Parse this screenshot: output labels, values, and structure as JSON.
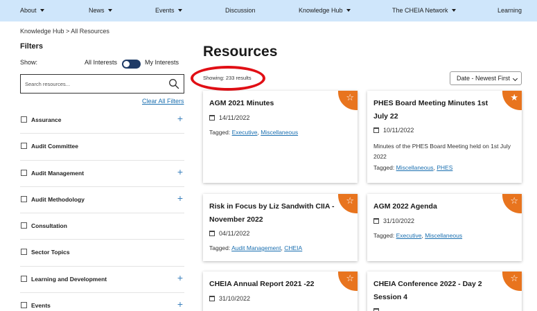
{
  "nav": {
    "items": [
      {
        "label": "About",
        "caret": true
      },
      {
        "label": "News",
        "caret": true
      },
      {
        "label": "Events",
        "caret": true
      },
      {
        "label": "Discussion",
        "caret": false
      },
      {
        "label": "Knowledge Hub",
        "caret": true
      },
      {
        "label": "The CHEIA Network",
        "caret": true
      },
      {
        "label": "Learning",
        "caret": false
      }
    ]
  },
  "breadcrumb": "Knowledge Hub > All Resources",
  "filters": {
    "title": "Filters",
    "show_label": "Show:",
    "all_interests": "All Interests",
    "my_interests": "My Interests",
    "search_placeholder": "Search resources...",
    "clear_all": "Clear All Filters",
    "items": [
      {
        "label": "Assurance",
        "expandable": true
      },
      {
        "label": "Audit Committee",
        "expandable": false
      },
      {
        "label": "Audit Management",
        "expandable": true
      },
      {
        "label": "Audit Methodology",
        "expandable": true
      },
      {
        "label": "Consultation",
        "expandable": false
      },
      {
        "label": "Sector Topics",
        "expandable": false
      },
      {
        "label": "Learning and Development",
        "expandable": true
      },
      {
        "label": "Events",
        "expandable": true
      }
    ]
  },
  "main": {
    "title": "Resources",
    "showing": "Showing: 233 results",
    "sort_value": "Date - Newest First",
    "tagged_prefix": "Tagged:",
    "cards": [
      {
        "title_lines": [
          "AGM 2021 Minutes"
        ],
        "date": "14/11/2022",
        "description": "",
        "tags": [
          "Executive",
          "Miscellaneous"
        ],
        "starred": false
      },
      {
        "title_lines": [
          "PHES Board Meeting Minutes 1st",
          "July 22"
        ],
        "date": "10/11/2022",
        "description": "Minutes of the PHES Board Meeting held on 1st July 2022",
        "tags": [
          "Miscellaneous",
          "PHES"
        ],
        "starred": true
      },
      {
        "title_lines": [
          "Risk in Focus by Liz Sandwith CIIA -",
          "November 2022"
        ],
        "date": "04/11/2022",
        "description": "",
        "tags": [
          "Audit Management",
          "CHEIA"
        ],
        "starred": false
      },
      {
        "title_lines": [
          "AGM 2022 Agenda"
        ],
        "date": "31/10/2022",
        "description": "",
        "tags": [
          "Executive",
          "Miscellaneous"
        ],
        "starred": false
      },
      {
        "title_lines": [
          "CHEIA Annual Report 2021 -22"
        ],
        "date": "31/10/2022",
        "description": "",
        "tags": [],
        "starred": false
      },
      {
        "title_lines": [
          "CHEIA Conference 2022 - Day 2",
          "Session 4"
        ],
        "date": "",
        "description": "",
        "tags": [],
        "starred": false
      }
    ]
  },
  "colors": {
    "nav_bg": "#cfe6fb",
    "accent_orange": "#e8741e",
    "link_blue": "#1a6fb0",
    "toggle_navy": "#1f3b66",
    "highlight_red": "#e10f15"
  }
}
